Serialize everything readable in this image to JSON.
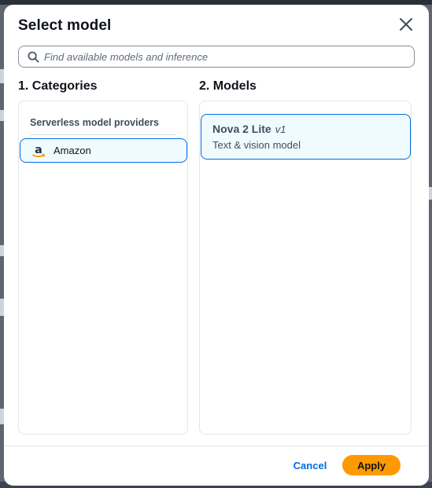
{
  "modal": {
    "title": "Select model",
    "close_icon": "close-icon"
  },
  "search": {
    "placeholder": "Find available models and inference",
    "value": "",
    "icon": "search-icon"
  },
  "categories": {
    "heading": "1. Categories",
    "group_label": "Serverless model providers",
    "providers": [
      {
        "label": "Amazon",
        "icon": "amazon-logo-icon",
        "selected": true
      }
    ]
  },
  "models": {
    "heading": "2. Models",
    "items": [
      {
        "name": "Nova 2 Lite",
        "version": "v1",
        "description": "Text & vision model",
        "selected": true
      }
    ]
  },
  "footer": {
    "cancel_label": "Cancel",
    "apply_label": "Apply"
  },
  "colors": {
    "accent": "#006ce0",
    "selected_bg": "#f0fbff",
    "primary_button": "#ff9900"
  }
}
